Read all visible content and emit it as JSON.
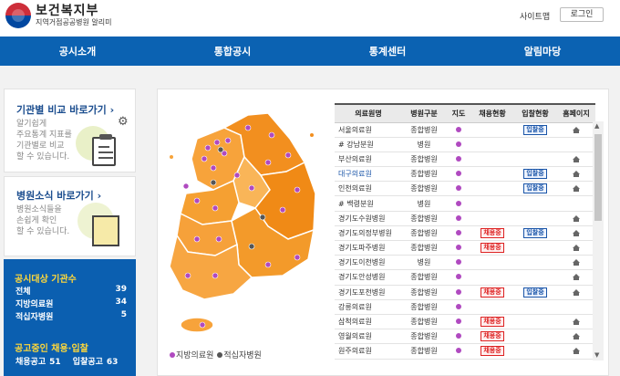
{
  "header": {
    "logo_title": "보건복지부",
    "logo_sub": "지역거점공공병원 알리미",
    "site_map": "사이트맵",
    "login": "로그인"
  },
  "nav": [
    "공시소개",
    "통합공시",
    "통계센터",
    "알림마당"
  ],
  "panel_compare": {
    "title": "기관별 비교 바로가기 ›",
    "desc": [
      "알기쉽게",
      "주요통계 지표를",
      "기관별로 비교",
      "할 수 있습니다."
    ]
  },
  "panel_news": {
    "title": "병원소식 바로가기 ›",
    "desc": [
      "병원소식들을",
      "손쉽게 확인",
      "할 수 있습니다."
    ]
  },
  "stats": {
    "title1": "공시대상 기관수",
    "rows": [
      {
        "label": "전체",
        "value": "39"
      },
      {
        "label": "지방의료원",
        "value": "34"
      },
      {
        "label": "적십자병원",
        "value": "5"
      }
    ],
    "title2": "공고중인 채용·입찰",
    "hire_label": "채용공고",
    "hire_value": "51",
    "bid_label": "입찰공고",
    "bid_value": "63"
  },
  "legend": {
    "local": "지방의료원",
    "redcross": "적십자병원",
    "local_color": "#b04ac0",
    "redcross_color": "#555555"
  },
  "table": {
    "headers": [
      "의료원명",
      "병원구분",
      "지도",
      "채용현황",
      "입찰현황",
      "홈페이지"
    ],
    "rows": [
      {
        "name": "서울의료원",
        "type": "종합병원",
        "hire": "",
        "bid": "입찰중",
        "home": true,
        "link": false
      },
      {
        "name": "# 강남분원",
        "type": "병원",
        "hire": "",
        "bid": "",
        "home": false,
        "link": false
      },
      {
        "name": "부산의료원",
        "type": "종합병원",
        "hire": "",
        "bid": "",
        "home": true,
        "link": false
      },
      {
        "name": "대구의료원",
        "type": "종합병원",
        "hire": "",
        "bid": "입찰중",
        "home": true,
        "link": true
      },
      {
        "name": "인천의료원",
        "type": "종합병원",
        "hire": "",
        "bid": "입찰중",
        "home": true,
        "link": false
      },
      {
        "name": "# 백령분원",
        "type": "병원",
        "hire": "",
        "bid": "",
        "home": false,
        "link": false
      },
      {
        "name": "경기도수원병원",
        "type": "종합병원",
        "hire": "",
        "bid": "",
        "home": true,
        "link": false
      },
      {
        "name": "경기도의정부병원",
        "type": "종합병원",
        "hire": "채용중",
        "bid": "입찰중",
        "home": true,
        "link": false
      },
      {
        "name": "경기도파주병원",
        "type": "종합병원",
        "hire": "채용중",
        "bid": "",
        "home": true,
        "link": false
      },
      {
        "name": "경기도이천병원",
        "type": "병원",
        "hire": "",
        "bid": "",
        "home": true,
        "link": false
      },
      {
        "name": "경기도안성병원",
        "type": "종합병원",
        "hire": "",
        "bid": "",
        "home": true,
        "link": false
      },
      {
        "name": "경기도포천병원",
        "type": "종합병원",
        "hire": "채용중",
        "bid": "입찰중",
        "home": true,
        "link": false
      },
      {
        "name": "강릉의료원",
        "type": "종합병원",
        "hire": "",
        "bid": "",
        "home": false,
        "link": false
      },
      {
        "name": "삼척의료원",
        "type": "종합병원",
        "hire": "채용중",
        "bid": "",
        "home": true,
        "link": false
      },
      {
        "name": "영월의료원",
        "type": "종합병원",
        "hire": "채용중",
        "bid": "",
        "home": true,
        "link": false
      },
      {
        "name": "원주의료원",
        "type": "종합병원",
        "hire": "채용중",
        "bid": "",
        "home": true,
        "link": false
      }
    ]
  },
  "colors": {
    "nav_blue": "#0b62b2",
    "title_blue": "#1c4e8f",
    "stats_yellow": "#ffd83a",
    "map_orange": "#f5a032",
    "badge_red": "#dd2222"
  }
}
